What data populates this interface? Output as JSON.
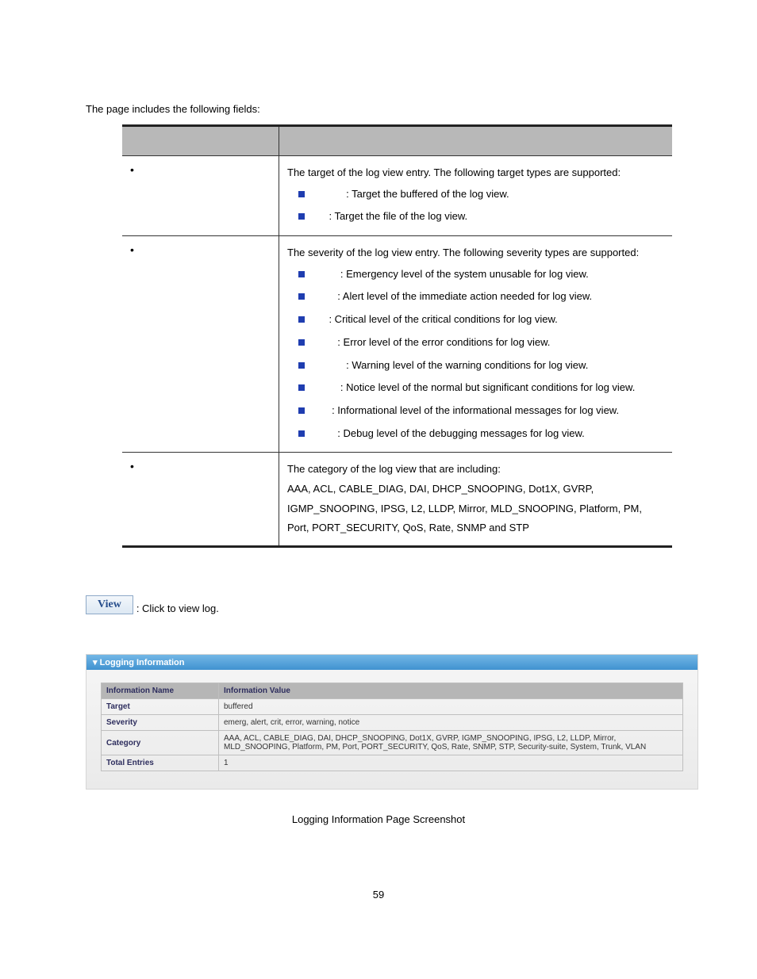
{
  "intro": "The page includes the following fields:",
  "header": {
    "object": "",
    "description": ""
  },
  "rows": [
    {
      "desc_lead": "The target of the log view entry. The following target types are supported:",
      "subs": [
        {
          "after": ": Target the buffered of the log view."
        },
        {
          "after": ": Target the file of the log view."
        }
      ]
    },
    {
      "desc_lead": "The severity of the log view entry. The following severity types are supported:",
      "subs": [
        {
          "after": ": Emergency level of the system unusable for log view."
        },
        {
          "after": ": Alert level of the immediate action needed for log view."
        },
        {
          "after": ": Critical level of the critical conditions for log view."
        },
        {
          "after": ": Error level of the error conditions for log view."
        },
        {
          "after": ": Warning level of the warning conditions for log view."
        },
        {
          "after": ": Notice level of the normal but significant conditions for log view."
        },
        {
          "after": ": Informational level of the informational messages for log view."
        },
        {
          "after": ": Debug level of the debugging messages for log view."
        }
      ]
    },
    {
      "desc_lead": "The category of the log view that are including:",
      "subs": [],
      "extra": [
        "AAA, ACL, CABLE_DIAG, DAI, DHCP_SNOOPING, Dot1X, GVRP,",
        "IGMP_SNOOPING, IPSG, L2, LLDP, Mirror, MLD_SNOOPING, Platform, PM,",
        "Port, PORT_SECURITY, QoS, Rate, SNMP and STP"
      ]
    }
  ],
  "view": {
    "button": "View",
    "text": ": Click to view log."
  },
  "panel": {
    "title": "Logging Information",
    "headers": {
      "name": "Information Name",
      "value": "Information Value"
    },
    "rows": [
      {
        "name": "Target",
        "value": "buffered"
      },
      {
        "name": "Severity",
        "value": "emerg, alert, crit, error, warning, notice"
      },
      {
        "name": "Category",
        "value": "AAA, ACL, CABLE_DIAG, DAI, DHCP_SNOOPING, Dot1X, GVRP, IGMP_SNOOPING, IPSG, L2, LLDP, Mirror, MLD_SNOOPING, Platform, PM, Port, PORT_SECURITY, QoS, Rate, SNMP, STP, Security-suite, System, Trunk, VLAN"
      },
      {
        "name": "Total Entries",
        "value": "1"
      }
    ]
  },
  "caption": "Logging Information Page Screenshot",
  "page_number": "59"
}
